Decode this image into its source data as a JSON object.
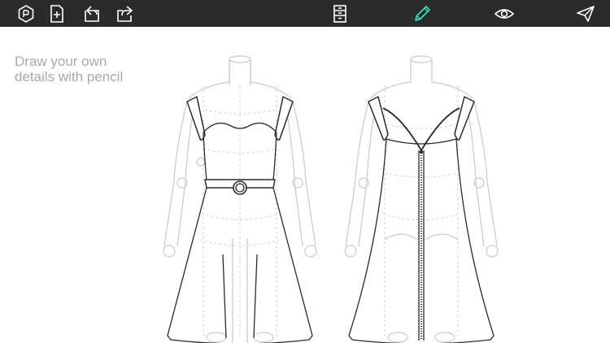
{
  "toolbar": {
    "buttons": [
      {
        "name": "logo-button",
        "icon": "hexagon-logo-icon"
      },
      {
        "name": "new-file-button",
        "icon": "new-file-plus-icon"
      },
      {
        "name": "undo-button",
        "icon": "undo-arrow-icon"
      },
      {
        "name": "export-button",
        "icon": "share-export-icon"
      },
      {
        "name": "layers-button",
        "icon": "layers-list-icon"
      },
      {
        "name": "pencil-button",
        "icon": "pencil-icon",
        "active": true
      },
      {
        "name": "preview-button",
        "icon": "eye-icon"
      },
      {
        "name": "send-button",
        "icon": "paper-plane-icon"
      }
    ],
    "colors": {
      "background": "#2b2b2b",
      "icon": "#ffffff",
      "active": "#3ddbc0"
    }
  },
  "hint": {
    "line1": "Draw your own",
    "line2": "details with pencil",
    "color": "#a9a9a9"
  },
  "logo_badge": "P",
  "sketches": {
    "front": {
      "view": "front",
      "garment": "dress with belt"
    },
    "back": {
      "view": "back",
      "garment": "dress with center zipper"
    }
  }
}
